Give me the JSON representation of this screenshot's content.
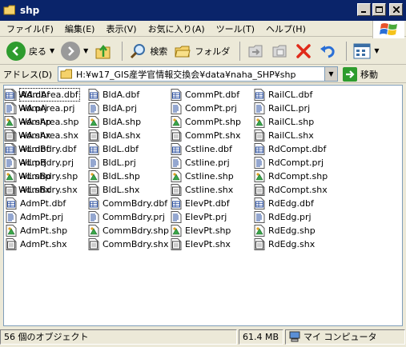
{
  "window": {
    "title": "shp"
  },
  "menu": [
    "ファイル(F)",
    "編集(E)",
    "表示(V)",
    "お気に入り(A)",
    "ツール(T)",
    "ヘルプ(H)"
  ],
  "toolbar": {
    "back_label": "戻る",
    "search_label": "検索",
    "folders_label": "フォルダ"
  },
  "address": {
    "label": "アドレス(D)",
    "path": "H:¥w17_GIS産学官情報交換会¥data¥naha_SHP¥shp",
    "go_label": "移動"
  },
  "files": [
    {
      "name": "AdmArea.dbf",
      "type": "dbf",
      "selected": true
    },
    {
      "name": "AdmArea.prj",
      "type": "prj"
    },
    {
      "name": "AdmArea.shp",
      "type": "shp"
    },
    {
      "name": "AdmArea.shx",
      "type": "shx"
    },
    {
      "name": "AdmBdry.dbf",
      "type": "dbf"
    },
    {
      "name": "AdmBdry.prj",
      "type": "prj"
    },
    {
      "name": "AdmBdry.shp",
      "type": "shp"
    },
    {
      "name": "AdmBdry.shx",
      "type": "shx"
    },
    {
      "name": "AdmPt.dbf",
      "type": "dbf"
    },
    {
      "name": "AdmPt.prj",
      "type": "prj"
    },
    {
      "name": "AdmPt.shp",
      "type": "shp"
    },
    {
      "name": "AdmPt.shx",
      "type": "shx"
    },
    {
      "name": "BldA.dbf",
      "type": "dbf"
    },
    {
      "name": "BldA.prj",
      "type": "prj"
    },
    {
      "name": "BldA.shp",
      "type": "shp"
    },
    {
      "name": "BldA.shx",
      "type": "shx"
    },
    {
      "name": "BldL.dbf",
      "type": "dbf"
    },
    {
      "name": "BldL.prj",
      "type": "prj"
    },
    {
      "name": "BldL.shp",
      "type": "shp"
    },
    {
      "name": "BldL.shx",
      "type": "shx"
    },
    {
      "name": "CommBdry.dbf",
      "type": "dbf"
    },
    {
      "name": "CommBdry.prj",
      "type": "prj"
    },
    {
      "name": "CommBdry.shp",
      "type": "shp"
    },
    {
      "name": "CommBdry.shx",
      "type": "shx"
    },
    {
      "name": "CommPt.dbf",
      "type": "dbf"
    },
    {
      "name": "CommPt.prj",
      "type": "prj"
    },
    {
      "name": "CommPt.shp",
      "type": "shp"
    },
    {
      "name": "CommPt.shx",
      "type": "shx"
    },
    {
      "name": "Cstline.dbf",
      "type": "dbf"
    },
    {
      "name": "Cstline.prj",
      "type": "prj"
    },
    {
      "name": "Cstline.shp",
      "type": "shp"
    },
    {
      "name": "Cstline.shx",
      "type": "shx"
    },
    {
      "name": "ElevPt.dbf",
      "type": "dbf"
    },
    {
      "name": "ElevPt.prj",
      "type": "prj"
    },
    {
      "name": "ElevPt.shp",
      "type": "shp"
    },
    {
      "name": "ElevPt.shx",
      "type": "shx"
    },
    {
      "name": "RailCL.dbf",
      "type": "dbf"
    },
    {
      "name": "RailCL.prj",
      "type": "prj"
    },
    {
      "name": "RailCL.shp",
      "type": "shp"
    },
    {
      "name": "RailCL.shx",
      "type": "shx"
    },
    {
      "name": "RdCompt.dbf",
      "type": "dbf"
    },
    {
      "name": "RdCompt.prj",
      "type": "prj"
    },
    {
      "name": "RdCompt.shp",
      "type": "shp"
    },
    {
      "name": "RdCompt.shx",
      "type": "shx"
    },
    {
      "name": "RdEdg.dbf",
      "type": "dbf"
    },
    {
      "name": "RdEdg.prj",
      "type": "prj"
    },
    {
      "name": "RdEdg.shp",
      "type": "shp"
    },
    {
      "name": "RdEdg.shx",
      "type": "shx"
    },
    {
      "name": "WA.dbf",
      "type": "dbf"
    },
    {
      "name": "WA.prj",
      "type": "prj"
    },
    {
      "name": "WA.shp",
      "type": "shp"
    },
    {
      "name": "WA.shx",
      "type": "shx"
    },
    {
      "name": "WL.dbf",
      "type": "dbf"
    },
    {
      "name": "WL.prj",
      "type": "prj"
    },
    {
      "name": "WL.shp",
      "type": "shp"
    },
    {
      "name": "WL.shx",
      "type": "shx"
    }
  ],
  "status": {
    "count": "56 個のオブジェクト",
    "size": "61.4 MB",
    "location": "マイ コンピュータ"
  },
  "colors": {
    "titlebar": "#0a246a",
    "window_bg": "#ece9d8",
    "back_green": "#2e9c2e",
    "forward_gray": "#9a9a9a",
    "go_green": "#2e9c2e"
  }
}
